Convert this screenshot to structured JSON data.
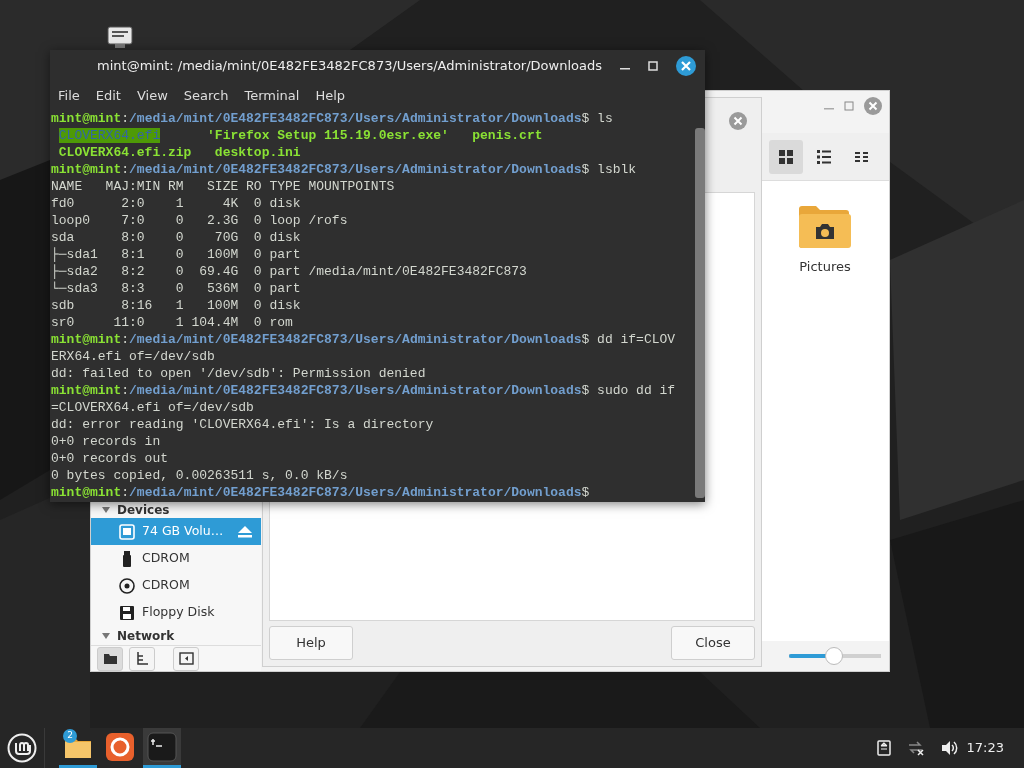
{
  "file_manager": {
    "sidebar": {
      "sections": [
        {
          "title": "Devices",
          "items": [
            {
              "kind": "drive",
              "label": "74 GB Volu…",
              "selected": true,
              "ejectable": true
            },
            {
              "kind": "usb",
              "label": "CDROM",
              "selected": false,
              "ejectable": false
            },
            {
              "kind": "disc",
              "label": "CDROM",
              "selected": false,
              "ejectable": false
            },
            {
              "kind": "floppy",
              "label": "Floppy Disk",
              "selected": false,
              "ejectable": false
            }
          ]
        },
        {
          "title": "Network"
        }
      ],
      "bottom_buttons": [
        {
          "kind": "places",
          "selected": true
        },
        {
          "kind": "tree",
          "selected": false
        },
        {
          "kind": "toggle",
          "selected": false
        }
      ]
    },
    "view_buttons": [
      {
        "kind": "grid",
        "selected": true
      },
      {
        "kind": "list",
        "selected": false
      },
      {
        "kind": "compact",
        "selected": false
      }
    ],
    "items": [
      {
        "kind": "pictures",
        "label": "Pictures"
      }
    ],
    "zoom_slider": {
      "level": 0.49
    }
  },
  "dialog": {
    "buttons": [
      "Help",
      "Close"
    ]
  },
  "terminal": {
    "title": "mint@mint: /media/mint/0E482FE3482FC873/Users/Administrator/Downloads",
    "menu": [
      "File",
      "Edit",
      "View",
      "Search",
      "Terminal",
      "Help"
    ],
    "lines": [
      {
        "segments": [
          {
            "kind": "user",
            "text": "mint@mint"
          },
          {
            "kind": "plain",
            "text": ":"
          },
          {
            "kind": "path",
            "text": "/media/mint/0E482FE3482FC873/Users/Administrator/Downloads"
          },
          {
            "kind": "plain",
            "text": "$ ls"
          }
        ]
      },
      {
        "indented": true,
        "segments": [
          {
            "kind": "highlight",
            "text": "CLOVERX64.efi"
          },
          {
            "kind": "file",
            "text": "      'Firefox Setup 115.19.0esr.exe'   penis.crt"
          }
        ]
      },
      {
        "segments": [
          {
            "kind": "file",
            "text": " CLOVERX64.efi.zip   desktop.ini"
          }
        ]
      },
      {
        "segments": [
          {
            "kind": "user",
            "text": "mint@mint"
          },
          {
            "kind": "plain",
            "text": ":"
          },
          {
            "kind": "path",
            "text": "/media/mint/0E482FE3482FC873/Users/Administrator/Downloads"
          },
          {
            "kind": "plain",
            "text": "$ lsblk"
          }
        ]
      },
      {
        "segments": [
          {
            "kind": "plain",
            "text": "NAME   MAJ:MIN RM   SIZE RO TYPE MOUNTPOINTS"
          }
        ]
      },
      {
        "segments": [
          {
            "kind": "plain",
            "text": "fd0      2:0    1     4K  0 disk"
          }
        ]
      },
      {
        "segments": [
          {
            "kind": "plain",
            "text": "loop0    7:0    0   2.3G  0 loop /rofs"
          }
        ]
      },
      {
        "segments": [
          {
            "kind": "plain",
            "text": "sda      8:0    0    70G  0 disk"
          }
        ]
      },
      {
        "segments": [
          {
            "kind": "plain",
            "text": "├─sda1   8:1    0   100M  0 part"
          }
        ]
      },
      {
        "segments": [
          {
            "kind": "plain",
            "text": "├─sda2   8:2    0  69.4G  0 part /media/mint/0E482FE3482FC873"
          }
        ]
      },
      {
        "segments": [
          {
            "kind": "plain",
            "text": "└─sda3   8:3    0   536M  0 part"
          }
        ]
      },
      {
        "segments": [
          {
            "kind": "plain",
            "text": "sdb      8:16   1   100M  0 disk"
          }
        ]
      },
      {
        "segments": [
          {
            "kind": "plain",
            "text": "sr0     11:0    1 104.4M  0 rom"
          }
        ]
      },
      {
        "segments": [
          {
            "kind": "user",
            "text": "mint@mint"
          },
          {
            "kind": "plain",
            "text": ":"
          },
          {
            "kind": "path",
            "text": "/media/mint/0E482FE3482FC873/Users/Administrator/Downloads"
          },
          {
            "kind": "plain",
            "text": "$ dd if=CLOV"
          }
        ]
      },
      {
        "segments": [
          {
            "kind": "plain",
            "text": "ERX64.efi of=/dev/sdb"
          }
        ]
      },
      {
        "segments": [
          {
            "kind": "plain",
            "text": "dd: failed to open '/dev/sdb': Permission denied"
          }
        ]
      },
      {
        "segments": [
          {
            "kind": "user",
            "text": "mint@mint"
          },
          {
            "kind": "plain",
            "text": ":"
          },
          {
            "kind": "path",
            "text": "/media/mint/0E482FE3482FC873/Users/Administrator/Downloads"
          },
          {
            "kind": "plain",
            "text": "$ sudo dd if"
          }
        ]
      },
      {
        "segments": [
          {
            "kind": "plain",
            "text": "=CLOVERX64.efi of=/dev/sdb"
          }
        ]
      },
      {
        "segments": [
          {
            "kind": "plain",
            "text": "dd: error reading 'CLOVERX64.efi': Is a directory"
          }
        ]
      },
      {
        "segments": [
          {
            "kind": "plain",
            "text": "0+0 records in"
          }
        ]
      },
      {
        "segments": [
          {
            "kind": "plain",
            "text": "0+0 records out"
          }
        ]
      },
      {
        "segments": [
          {
            "kind": "plain",
            "text": "0 bytes copied, 0.00263511 s, 0.0 kB/s"
          }
        ]
      },
      {
        "segments": [
          {
            "kind": "user",
            "text": "mint@mint"
          },
          {
            "kind": "plain",
            "text": ":"
          },
          {
            "kind": "path",
            "text": "/media/mint/0E482FE3482FC873/Users/Administrator/Downloads"
          },
          {
            "kind": "plain",
            "text": "$"
          }
        ]
      }
    ]
  },
  "taskbar": {
    "apps": [
      {
        "kind": "files",
        "badge": "2",
        "running": true,
        "active": false
      },
      {
        "kind": "browser",
        "running": false,
        "active": false
      },
      {
        "kind": "terminal",
        "running": true,
        "active": true
      }
    ],
    "clock": "17:23"
  }
}
